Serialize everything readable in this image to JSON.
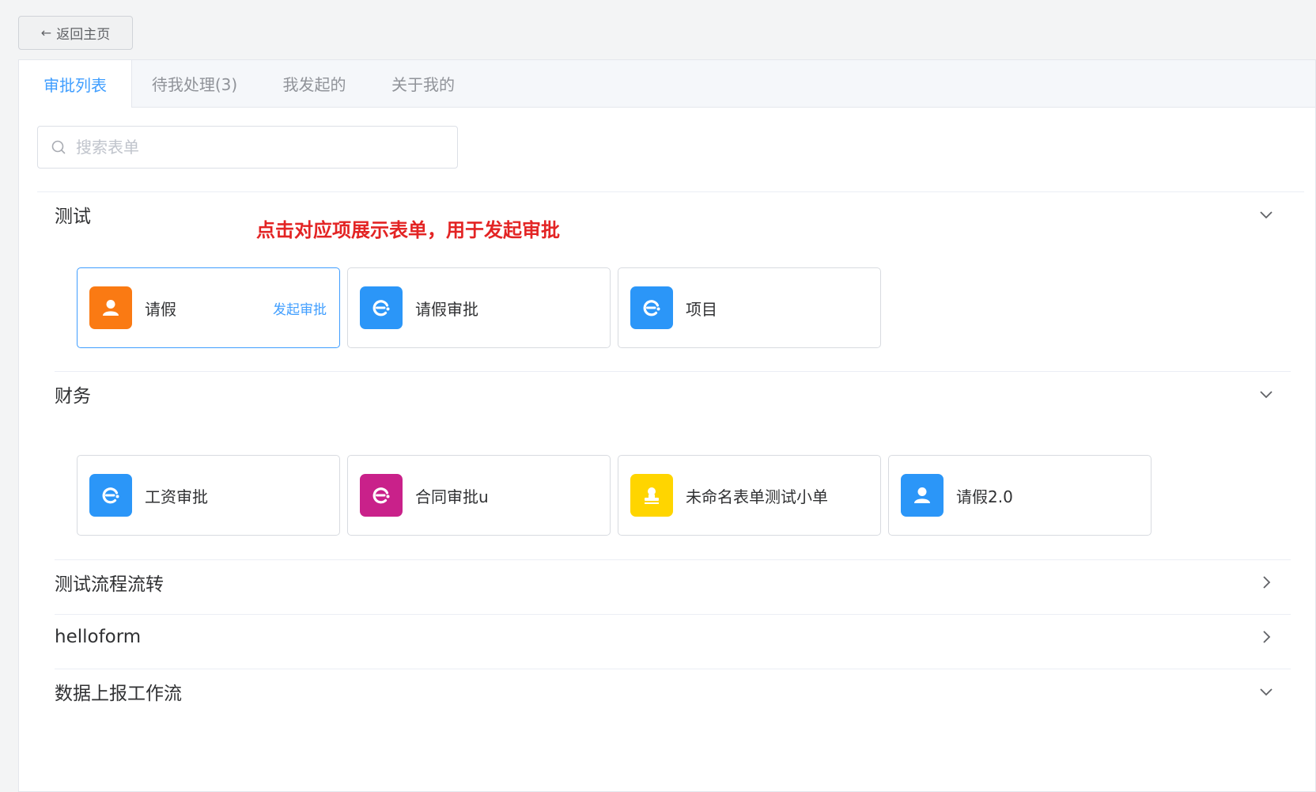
{
  "back_button": {
    "label": "返回主页"
  },
  "tabs": [
    {
      "label": "审批列表",
      "active": true
    },
    {
      "label": "待我处理(3)",
      "active": false
    },
    {
      "label": "我发起的",
      "active": false
    },
    {
      "label": "关于我的",
      "active": false
    }
  ],
  "search": {
    "placeholder": "搜索表单",
    "value": ""
  },
  "annotation": "点击对应项展示表单，用于发起审批",
  "groups": [
    {
      "title": "测试",
      "expanded": true,
      "forms": [
        {
          "name": "请假",
          "icon": "user-icon",
          "color": "#fa7a13",
          "action": "发起审批",
          "hovered": true
        },
        {
          "name": "请假审批",
          "icon": "e-logo-icon",
          "color": "#2b96f8"
        },
        {
          "name": "项目",
          "icon": "e-logo-icon",
          "color": "#2b96f8"
        }
      ]
    },
    {
      "title": "财务",
      "expanded": true,
      "forms": [
        {
          "name": "工资审批",
          "icon": "e-logo-icon",
          "color": "#2b96f8"
        },
        {
          "name": "合同审批u",
          "icon": "e-logo-icon",
          "color": "#c9218a"
        },
        {
          "name": "未命名表单测试小单",
          "icon": "stamp-icon",
          "color": "#ffd500"
        },
        {
          "name": "请假2.0",
          "icon": "user-icon",
          "color": "#2b96f8"
        }
      ]
    },
    {
      "title": "测试流程流转",
      "expanded": false
    },
    {
      "title": "helloform",
      "expanded": false
    },
    {
      "title": "数据上报工作流",
      "expanded": true,
      "forms": []
    }
  ],
  "colors": {
    "accent": "#409eff",
    "annotation": "#e32424",
    "border": "#dcdfe6"
  }
}
